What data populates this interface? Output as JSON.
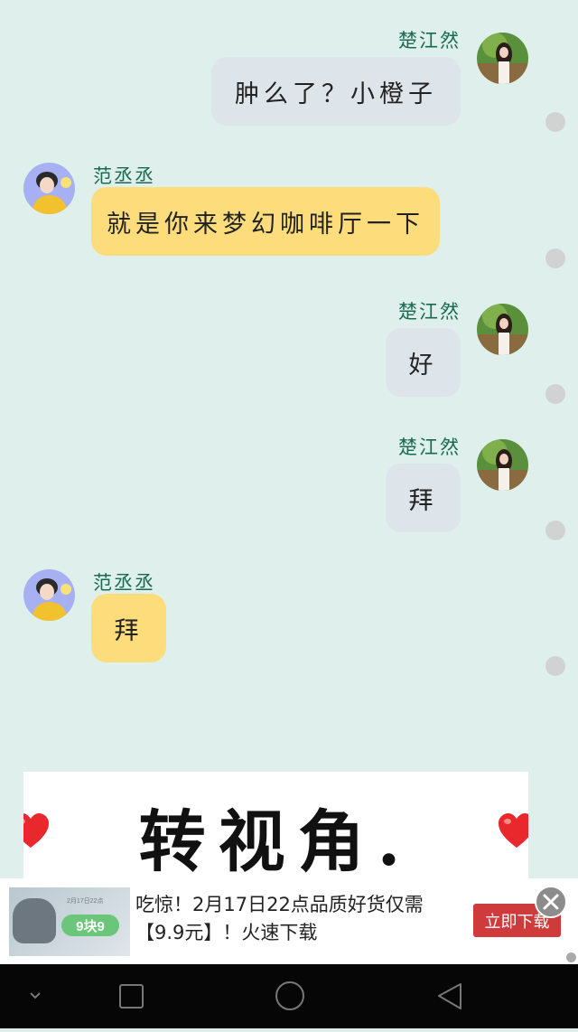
{
  "messages": [
    {
      "sender": "楚江然",
      "side": "right",
      "text": "肿么了？小橙子"
    },
    {
      "sender": "范丞丞",
      "side": "left",
      "text": "就是你来梦幻咖啡厅一下"
    },
    {
      "sender": "楚江然",
      "side": "right",
      "text": "好"
    },
    {
      "sender": "楚江然",
      "side": "right",
      "text": "拜"
    },
    {
      "sender": "范丞丞",
      "side": "left",
      "text": "拜"
    }
  ],
  "banner": {
    "text": "转视角."
  },
  "ad": {
    "text": "吃惊！2月17日22点品质好货仅需【9.9元】！火速下载",
    "button_label": "立即下载",
    "thumb_price": "9块9",
    "thumb_caption": "2月17日22点"
  },
  "colors": {
    "background": "#dff0ec",
    "right_bubble": "#dee5ea",
    "left_bubble": "#fddc7b",
    "sender_name": "#1a6a52",
    "ad_button": "#cf3b3b",
    "navbar": "#060606"
  },
  "icons": [
    "avatar-female",
    "avatar-male",
    "heart-icon",
    "close-icon",
    "nav-back-icon",
    "nav-home-icon",
    "nav-recents-icon",
    "nav-menu-icon"
  ]
}
